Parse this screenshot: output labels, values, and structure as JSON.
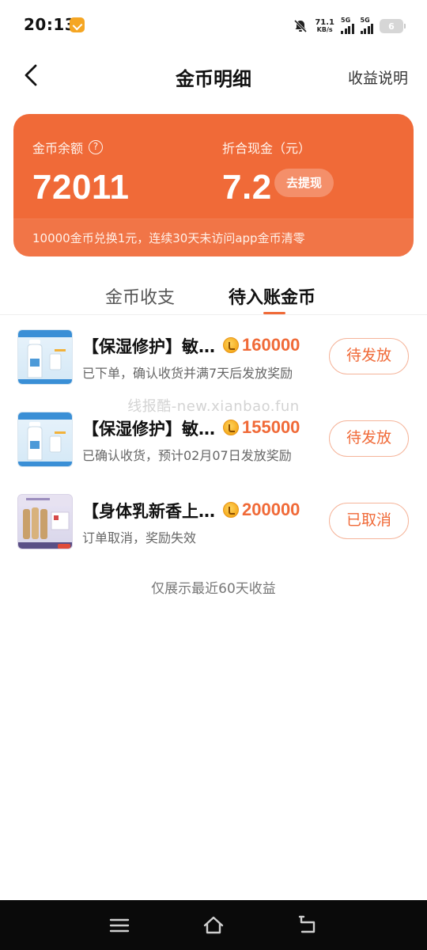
{
  "status_bar": {
    "time": "20:13",
    "net_speed_value": "71.1",
    "net_speed_unit": "KB/s",
    "signal_1_label": "5G",
    "signal_2_label": "5G",
    "battery_level": "6"
  },
  "nav": {
    "title": "金币明细",
    "right_link": "收益说明"
  },
  "balance": {
    "coins_label": "金币余额",
    "coins_value": "72011",
    "cash_label": "折合现金（元）",
    "cash_value": "7.2",
    "withdraw_label": "去提现",
    "footer_note": "10000金币兑换1元，连续30天未访问app金币清零",
    "accent_color": "#f06a38"
  },
  "tabs": [
    {
      "label": "金币收支",
      "active": false
    },
    {
      "label": "待入账金币",
      "active": true
    }
  ],
  "orders": [
    {
      "title": "【保湿修护】敏…",
      "coins": "160000",
      "desc": "已下单，确认收货并满7天后发放奖励",
      "status": "待发放"
    },
    {
      "title": "【保湿修护】敏…",
      "coins": "155000",
      "desc": "已确认收货，预计02月07日发放奖励",
      "status": "待发放"
    },
    {
      "title": "【身体乳新香上…",
      "coins": "200000",
      "desc": "订单取消，奖励失效",
      "status": "已取消"
    }
  ],
  "watermark": "线报酷-new.xianbao.fun",
  "list_footer": "仅展示最近60天收益"
}
